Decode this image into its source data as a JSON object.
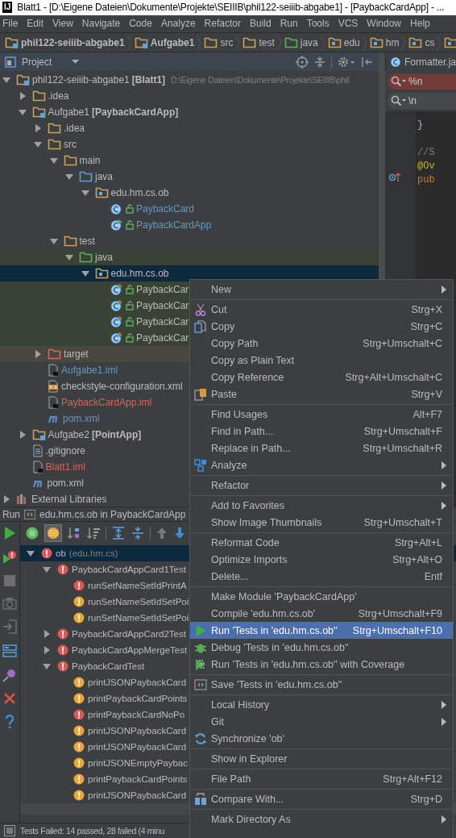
{
  "window": {
    "logo": "IJ",
    "title": "Blatt1 - [D:\\Eigene Dateien\\Dokumente\\Projekte\\SEIIIB\\phil122-seiiib-abgabe1] - [PaybackCardApp] - ..."
  },
  "menu_bar": [
    "File",
    "Edit",
    "View",
    "Navigate",
    "Code",
    "Analyze",
    "Refactor",
    "Build",
    "Run",
    "Tools",
    "VCS",
    "Window",
    "Help"
  ],
  "breadcrumbs": [
    {
      "label": "phil122-seiiib-abgabe1",
      "kind": "module"
    },
    {
      "label": "Aufgabe1",
      "kind": "module"
    },
    {
      "label": "src",
      "kind": "folder"
    },
    {
      "label": "test",
      "kind": "folder"
    },
    {
      "label": "java",
      "kind": "test-root"
    },
    {
      "label": "edu",
      "kind": "package"
    },
    {
      "label": "hm",
      "kind": "package"
    },
    {
      "label": "cs",
      "kind": "package"
    },
    {
      "kind": "package"
    }
  ],
  "project_panel": {
    "title": "Project"
  },
  "tree": [
    {
      "label": "phil122-seiiib-abgabe1 **[Blatt1]**",
      "path": "D:\\Eigene Dateien\\Dokumente\\Projekte\\SEIIIB\\phil",
      "kind": "module",
      "expanded": true,
      "selected": false,
      "children": [
        {
          "label": ".idea",
          "kind": "folder",
          "expanded": false,
          "selected": false
        },
        {
          "label": "Aufgabe1 **[PaybackCardApp]**",
          "kind": "module",
          "expanded": true,
          "selected": false,
          "children": [
            {
              "label": ".idea",
              "kind": "folder",
              "expanded": false,
              "selected": false
            },
            {
              "label": "src",
              "kind": "folder",
              "expanded": true,
              "selected": false,
              "children": [
                {
                  "label": "main",
                  "kind": "folder",
                  "expanded": true,
                  "selected": false,
                  "children": [
                    {
                      "label": "java",
                      "kind": "source-root",
                      "expanded": true,
                      "selected": false,
                      "children": [
                        {
                          "label": "edu.hm.cs.ob",
                          "kind": "package",
                          "expanded": true,
                          "selected": false,
                          "children": [
                            {
                              "label": "PaybackCard",
                              "kind": "class",
                              "color": "#6897bb",
                              "selected": false
                            },
                            {
                              "label": "PaybackCardApp",
                              "kind": "main-class",
                              "color": "#6897bb",
                              "selected": false
                            }
                          ]
                        }
                      ]
                    }
                  ]
                },
                {
                  "label": "test",
                  "kind": "folder",
                  "expanded": true,
                  "selected": false,
                  "children": [
                    {
                      "label": "java",
                      "kind": "test-root",
                      "test_source": true,
                      "expanded": true,
                      "selected": false,
                      "children": [
                        {
                          "label": "edu.hm.cs.ob",
                          "kind": "package",
                          "expanded": true,
                          "selected": true,
                          "children": [
                            {
                              "label": "PaybackCar",
                              "kind": "test-class",
                              "test_source": true,
                              "selected": false
                            },
                            {
                              "label": "PaybackCar",
                              "kind": "test-class",
                              "test_source": true,
                              "selected": false
                            },
                            {
                              "label": "PaybackCar",
                              "kind": "test-class",
                              "test_source": true,
                              "selected": false
                            },
                            {
                              "label": "PaybackCar",
                              "kind": "test-class",
                              "test_source": true,
                              "selected": false
                            }
                          ]
                        }
                      ]
                    }
                  ]
                }
              ]
            },
            {
              "label": "target",
              "kind": "excluded",
              "excluded": true,
              "expanded": false,
              "selected": false
            },
            {
              "label": "Aufgabe1.iml",
              "kind": "module-file",
              "color": "#6897bb",
              "selected": false
            },
            {
              "label": "checkstyle-configuration.xml",
              "kind": "xml-file",
              "selected": false
            },
            {
              "label": "PaybackCardApp.iml",
              "kind": "module-file",
              "color": "#d1675a",
              "selected": false
            },
            {
              "label": "pom.xml",
              "kind": "maven-file",
              "color": "#6897bb",
              "selected": false
            }
          ]
        },
        {
          "label": "Aufgabe2 **[PointApp]**",
          "kind": "module",
          "expanded": false,
          "selected": false
        },
        {
          "label": ".gitignore",
          "kind": "text-file",
          "selected": false
        },
        {
          "label": "Blatt1.iml",
          "kind": "module-file",
          "color": "#d1675a",
          "selected": false
        },
        {
          "label": "pom.xml",
          "kind": "maven-file",
          "selected": false
        }
      ]
    },
    {
      "label": "External Libraries",
      "kind": "libraries",
      "expanded": false,
      "selected": false
    }
  ],
  "editor": {
    "tab": "Formatter.ja",
    "find_fields": [
      {
        "value": "%n",
        "no_match": true
      },
      {
        "value": "\\n",
        "no_match": false
      }
    ],
    "lines": [
      {
        "text": "}",
        "kind": "plain"
      },
      {
        "text": "//S",
        "kind": "comment",
        "blank_before": true
      },
      {
        "text": "@Ov",
        "kind": "annotation"
      },
      {
        "text": "pub",
        "kind": "keyword"
      }
    ]
  },
  "run_panel": {
    "label": "Run",
    "config": "edu.hm.cs.ob in PaybackCardApp",
    "tests": [
      {
        "name": "ob",
        "detail": "(edu.hm.cs)",
        "kind": "error",
        "expanded": true,
        "selected": true,
        "children": [
          {
            "name": "PaybackCardAppCard1Test",
            "kind": "error",
            "expanded": true,
            "selected": false,
            "children": [
              {
                "name": "runSetNameSetIdPrintA",
                "kind": "error",
                "selected": false
              },
              {
                "name": "runSetNameSetIdSetPoi",
                "kind": "warning",
                "selected": false
              },
              {
                "name": "runSetNameSetIdSetPoi",
                "kind": "warning",
                "selected": false
              }
            ]
          },
          {
            "name": "PaybackCardAppCard2Test",
            "kind": "error",
            "expanded": false,
            "selected": false
          },
          {
            "name": "PaybackCardAppMergeTest",
            "kind": "error",
            "expanded": false,
            "selected": false
          },
          {
            "name": "PaybackCardTest",
            "kind": "error",
            "expanded": true,
            "selected": false,
            "children": [
              {
                "name": "printJSONPaybackCard",
                "kind": "warning",
                "selected": false
              },
              {
                "name": "printPaybackCardPoints",
                "kind": "warning",
                "selected": false
              },
              {
                "name": "printPaybackCardNoPo",
                "kind": "error",
                "selected": false
              },
              {
                "name": "printJSONPaybackCard",
                "kind": "warning",
                "selected": false
              },
              {
                "name": "printJSONPaybackCard",
                "kind": "warning",
                "selected": false
              },
              {
                "name": "printJSONEmptyPaybac",
                "kind": "warning",
                "selected": false
              },
              {
                "name": "printPaybackCardPoints",
                "kind": "warning",
                "selected": false
              },
              {
                "name": "printJSONPaybackCard",
                "kind": "warning",
                "selected": false
              }
            ]
          }
        ]
      }
    ]
  },
  "status_bar": {
    "text": "Tests Failed: 14 passed, 28 failed (4 minu"
  },
  "context_menu": {
    "groups": [
      [
        {
          "label": "New",
          "submenu": true,
          "selected": false
        }
      ],
      [
        {
          "label": "Cut",
          "shortcut": "Strg+X",
          "selected": false
        },
        {
          "label": "Copy",
          "shortcut": "Strg+C",
          "selected": false
        },
        {
          "label": "Copy Path",
          "shortcut": "Strg+Umschalt+C",
          "selected": false
        },
        {
          "label": "Copy as Plain Text",
          "selected": false
        },
        {
          "label": "Copy Reference",
          "shortcut": "Strg+Alt+Umschalt+C",
          "selected": false
        },
        {
          "label": "Paste",
          "shortcut": "Strg+V",
          "selected": false
        }
      ],
      [
        {
          "label": "Find Usages",
          "shortcut": "Alt+F7",
          "selected": false
        },
        {
          "label": "Find in Path...",
          "shortcut": "Strg+Umschalt+F",
          "selected": false
        },
        {
          "label": "Replace in Path...",
          "shortcut": "Strg+Umschalt+R",
          "selected": false
        },
        {
          "label": "Analyze",
          "submenu": true,
          "selected": false
        }
      ],
      [
        {
          "label": "Refactor",
          "submenu": true,
          "selected": false
        }
      ],
      [
        {
          "label": "Add to Favorites",
          "submenu": true,
          "selected": false
        },
        {
          "label": "Show Image Thumbnails",
          "shortcut": "Strg+Umschalt+T",
          "selected": false
        }
      ],
      [
        {
          "label": "Reformat Code",
          "shortcut": "Strg+Alt+L",
          "selected": false
        },
        {
          "label": "Optimize Imports",
          "shortcut": "Strg+Alt+O",
          "selected": false
        },
        {
          "label": "Delete...",
          "shortcut": "Entf",
          "selected": false
        }
      ],
      [
        {
          "label": "Make Module 'PaybackCardApp'",
          "selected": false
        },
        {
          "label": "Compile 'edu.hm.cs.ob'",
          "shortcut": "Strg+Umschalt+F9",
          "selected": false
        },
        {
          "label": "Run 'Tests in 'edu.hm.cs.ob''",
          "shortcut": "Strg+Umschalt+F10",
          "selected": true
        },
        {
          "label": "Debug 'Tests in 'edu.hm.cs.ob''",
          "selected": false
        },
        {
          "label": "Run 'Tests in 'edu.hm.cs.ob'' with Coverage",
          "selected": false
        }
      ],
      [
        {
          "label": "Save 'Tests in 'edu.hm.cs.ob''",
          "selected": false
        }
      ],
      [
        {
          "label": "Local History",
          "submenu": true,
          "selected": false
        },
        {
          "label": "Git",
          "submenu": true,
          "selected": false
        },
        {
          "label": "Synchronize 'ob'",
          "selected": false
        }
      ],
      [
        {
          "label": "Show in Explorer",
          "selected": false
        }
      ],
      [
        {
          "label": "File Path",
          "shortcut": "Strg+Alt+F12",
          "selected": false
        }
      ],
      [
        {
          "label": "Compare With...",
          "shortcut": "Strg+D",
          "selected": false
        }
      ],
      [
        {
          "label": "Mark Directory As",
          "submenu": true,
          "selected": false
        }
      ]
    ]
  }
}
